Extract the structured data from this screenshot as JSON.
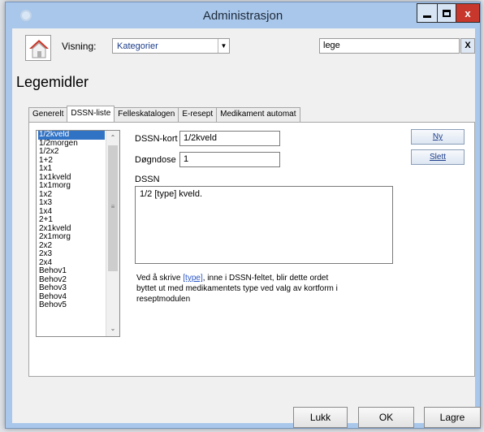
{
  "window": {
    "title": "Administrasjon",
    "close_label": "x"
  },
  "toolbar": {
    "visning_label": "Visning:",
    "visning_value": "Kategorier",
    "search_value": "lege",
    "search_clear_label": "X"
  },
  "page_title": "Legemidler",
  "tabs": [
    {
      "label": "Generelt"
    },
    {
      "label": "DSSN-liste",
      "active": true
    },
    {
      "label": "Felleskatalogen"
    },
    {
      "label": "E-resept"
    },
    {
      "label": "Medikament automat"
    }
  ],
  "list": {
    "items": [
      "1/2kveld",
      "1/2morgen",
      "1/2x2",
      "1+2",
      "1x1",
      "1x1kveld",
      "1x1morg",
      "1x2",
      "1x3",
      "1x4",
      "2+1",
      "2x1kveld",
      "2x1morg",
      "2x2",
      "2x3",
      "2x4",
      "Behov1",
      "Behov2",
      "Behov3",
      "Behov4",
      "Behov5"
    ],
    "selected": "1/2kveld"
  },
  "form": {
    "dssn_kort_label": "DSSN-kort",
    "dssn_kort_value": "1/2kveld",
    "dogndose_label": "Døgndose",
    "dogndose_value": "1",
    "dssn_label": "DSSN",
    "dssn_value": "1/2 [type] kveld.",
    "info_prefix": "Ved å skrive ",
    "info_type_link": "[type]",
    "info_line1_rest": ", inne i DSSN-feltet, blir dette ordet",
    "info_line2": "byttet ut med medikamentets type ved valg av kortform i",
    "info_line3": "reseptmodulen"
  },
  "side_buttons": {
    "ny": "Ny",
    "slett": "Slett"
  },
  "bottom_buttons": {
    "lukk": "Lukk",
    "ok": "OK",
    "lagre": "Lagre"
  },
  "colors": {
    "selection": "#3072c4",
    "window_frame": "#a9c7ea",
    "close_button": "#c8372b",
    "link": "#2a56c6"
  },
  "icons": [
    "gear-icon",
    "minimize-icon",
    "maximize-icon",
    "close-icon",
    "home-icon",
    "dropdown-arrow-icon"
  ]
}
